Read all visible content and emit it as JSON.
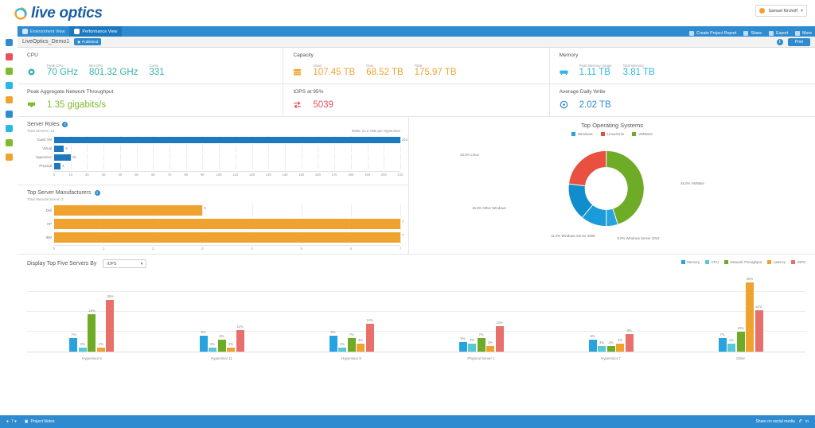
{
  "brand": {
    "name_part1": "live",
    "name_part2": "optics",
    "logo_icon": "live-optics-swirl-icon"
  },
  "account": {
    "name": "Samuel Kirchoff",
    "caret": "▾",
    "avatar_icon": "user-avatar-icon"
  },
  "tabs": [
    {
      "label": "Environment View",
      "icon": "cloud-icon",
      "active": false
    },
    {
      "label": "Performance View",
      "icon": "speedometer-icon",
      "active": true
    }
  ],
  "toolbar": [
    {
      "label": "Create Project Report",
      "icon": "document-icon"
    },
    {
      "label": "Share",
      "icon": "share-icon"
    },
    {
      "label": "Export",
      "icon": "export-icon"
    },
    {
      "label": "More",
      "icon": "ellipsis-icon"
    }
  ],
  "subheader": {
    "project_name": "LiveOptics_Demo1",
    "badge": "Published",
    "badge_icon": "globe-icon",
    "info_icon": "info-icon",
    "print_label": "Print"
  },
  "rail": [
    {
      "name": "dashboard-icon",
      "color": "#2e8bd0"
    },
    {
      "name": "chart-icon",
      "color": "#e8505b"
    },
    {
      "name": "folder-icon",
      "color": "#7fba2b"
    },
    {
      "name": "apps-icon",
      "color": "#29b6e8"
    },
    {
      "name": "user-icon",
      "color": "#f0a22e"
    },
    {
      "name": "globe-icon",
      "color": "#2e8bd0"
    },
    {
      "name": "settings-icon",
      "color": "#29b6e8"
    },
    {
      "name": "tools-icon",
      "color": "#7fba2b"
    },
    {
      "name": "help-icon",
      "color": "#f0a22e"
    }
  ],
  "stats": {
    "row1": [
      {
        "title": "CPU",
        "icon": "cpu-chip-icon",
        "color": "#36b3a8",
        "metrics": [
          {
            "label": "Peak CPU",
            "value": "70 GHz"
          },
          {
            "label": "Net CPU",
            "value": "801.32 GHz"
          },
          {
            "label": "Cores",
            "value": "331"
          }
        ]
      },
      {
        "title": "Capacity",
        "icon": "database-stack-icon",
        "color": "#f0a22e",
        "metrics": [
          {
            "label": "Used",
            "value": "107.45 TB"
          },
          {
            "label": "Free",
            "value": "68.52 TB"
          },
          {
            "label": "Total",
            "value": "175.97 TB"
          }
        ]
      },
      {
        "title": "Memory",
        "icon": "memory-module-icon",
        "color": "#29b6e8",
        "metrics": [
          {
            "label": "Peak Memory Usage",
            "value": "1.11 TB"
          },
          {
            "label": "Total Memory",
            "value": "3.81 TB"
          }
        ]
      }
    ],
    "row2": [
      {
        "title": "Peak Aggregate Network Throughput",
        "icon": "network-icon",
        "color": "#7fba2b",
        "metrics": [
          {
            "label": "",
            "value": "1.35 gigabits/s"
          }
        ]
      },
      {
        "title": "IOPS at 95%",
        "icon": "transfer-arrows-icon",
        "color": "#e8505b",
        "metrics": [
          {
            "label": "",
            "value": "5039"
          }
        ]
      },
      {
        "title": "Average Daily Write",
        "icon": "disk-write-icon",
        "color": "#2e8bd0",
        "metrics": [
          {
            "label": "",
            "value": "2.02 TB"
          }
        ]
      }
    ]
  },
  "server_roles": {
    "title": "Server Roles",
    "subtitle": "Total Servers: 14",
    "ratio": "Ratio: 21.2 VMs per Hypervisor",
    "info_icon": "info-icon",
    "chart_data": {
      "type": "bar",
      "orientation": "horizontal",
      "categories": [
        "Guest VM",
        "Virtual",
        "Hypervisor",
        "Physical"
      ],
      "values": [
        212,
        6,
        10,
        4
      ],
      "color": "#1c79c0",
      "xlim": [
        0,
        210
      ],
      "ticks": [
        0,
        10,
        20,
        30,
        40,
        50,
        60,
        70,
        80,
        90,
        100,
        110,
        120,
        130,
        140,
        150,
        160,
        170,
        180,
        190,
        200,
        210
      ],
      "ylabel": "",
      "xlabel": ""
    }
  },
  "server_manufacturers": {
    "title": "Top Server Manufacturers",
    "subtitle": "Total Manufacturers: 3",
    "info_icon": "info-icon",
    "chart_data": {
      "type": "bar",
      "orientation": "horizontal",
      "categories": [
        "Dell",
        "HP",
        "IBM"
      ],
      "values": [
        3,
        7,
        7
      ],
      "color": "#f0a22e",
      "xlim": [
        0,
        7
      ],
      "ticks": [
        0,
        1,
        2,
        3,
        4,
        5,
        6,
        7
      ],
      "ylabel": "",
      "xlabel": ""
    }
  },
  "operating_systems": {
    "title": "Top Operating Systems",
    "legend": [
      {
        "label": "Windows",
        "color": "#29a3e0"
      },
      {
        "label": "Linux/Unix",
        "color": "#e8503f"
      },
      {
        "label": "VMWare",
        "color": "#6eab26"
      }
    ],
    "chart_data": {
      "type": "pie",
      "donut": true,
      "title": "Top Operating Systems",
      "labels": [
        "VMWare",
        "Windows Server 2012",
        "Windows Server 2008",
        "Other Windows",
        "Linux"
      ],
      "values": [
        45.0,
        5.0,
        11.0,
        16.0,
        23.0
      ],
      "display_labels": [
        "45.0% VMWare",
        "5.0% Windows Server 2012",
        "11.0% Windows Server 2008",
        "16.0% Other Windows",
        "23.0% Linux"
      ],
      "colors": [
        "#6eab26",
        "#29a3e0",
        "#1b9bd8",
        "#0f8ecb",
        "#e8503f"
      ],
      "legend_position": "top"
    }
  },
  "top_servers": {
    "label": "Display Top Five Servers By",
    "select_value": "IOPS",
    "select_icon": "chevron-down-icon",
    "chart_data": {
      "type": "bar",
      "title": "Display Top Five Servers By",
      "categories": [
        "Hypervisor 6",
        "Hypervisor 11",
        "Hypervisor 8",
        "Physical Server 1",
        "Hypervisor 7",
        "Other"
      ],
      "series": [
        {
          "name": "Memory",
          "color": "#29a3e0",
          "values": [
            7,
            8,
            8,
            5,
            6,
            7
          ]
        },
        {
          "name": "CPU",
          "color": "#58c8d8",
          "values": [
            2,
            2,
            2,
            4,
            3,
            4
          ]
        },
        {
          "name": "Network Throughput",
          "color": "#6eab26",
          "values": [
            19,
            6,
            7,
            7,
            3,
            10
          ]
        },
        {
          "name": "Latency",
          "color": "#f0a22e",
          "values": [
            2,
            2,
            4,
            3,
            4,
            35
          ]
        },
        {
          "name": "IOPS",
          "color": "#e8706b",
          "values": [
            26,
            11,
            14,
            13,
            9,
            21
          ]
        }
      ],
      "display_labels": [
        [
          "7%",
          "2%",
          "19%",
          "2%",
          "26%"
        ],
        [
          "8%",
          "2%",
          "6%",
          "2%",
          "11%"
        ],
        [
          "8%",
          "2%",
          "7%",
          "4%",
          "14%"
        ],
        [
          "5%",
          "4%",
          "7%",
          "3%",
          "13%"
        ],
        [
          "6%",
          "3%",
          "3%",
          "4%",
          "9%"
        ],
        [
          "7%",
          "4%",
          "10%",
          "35%",
          "21%"
        ]
      ],
      "ylim": [
        0,
        40
      ],
      "ylabel": "",
      "xlabel": "",
      "legend_position": "top-right"
    }
  },
  "footer": {
    "left": [
      {
        "label": "7 ▾",
        "icon": "notification-icon"
      },
      {
        "label": "Project Notes",
        "icon": "notes-icon"
      }
    ],
    "share_label": "Share on social media",
    "social": [
      {
        "name": "twitter-icon"
      },
      {
        "name": "linkedin-icon"
      }
    ]
  }
}
